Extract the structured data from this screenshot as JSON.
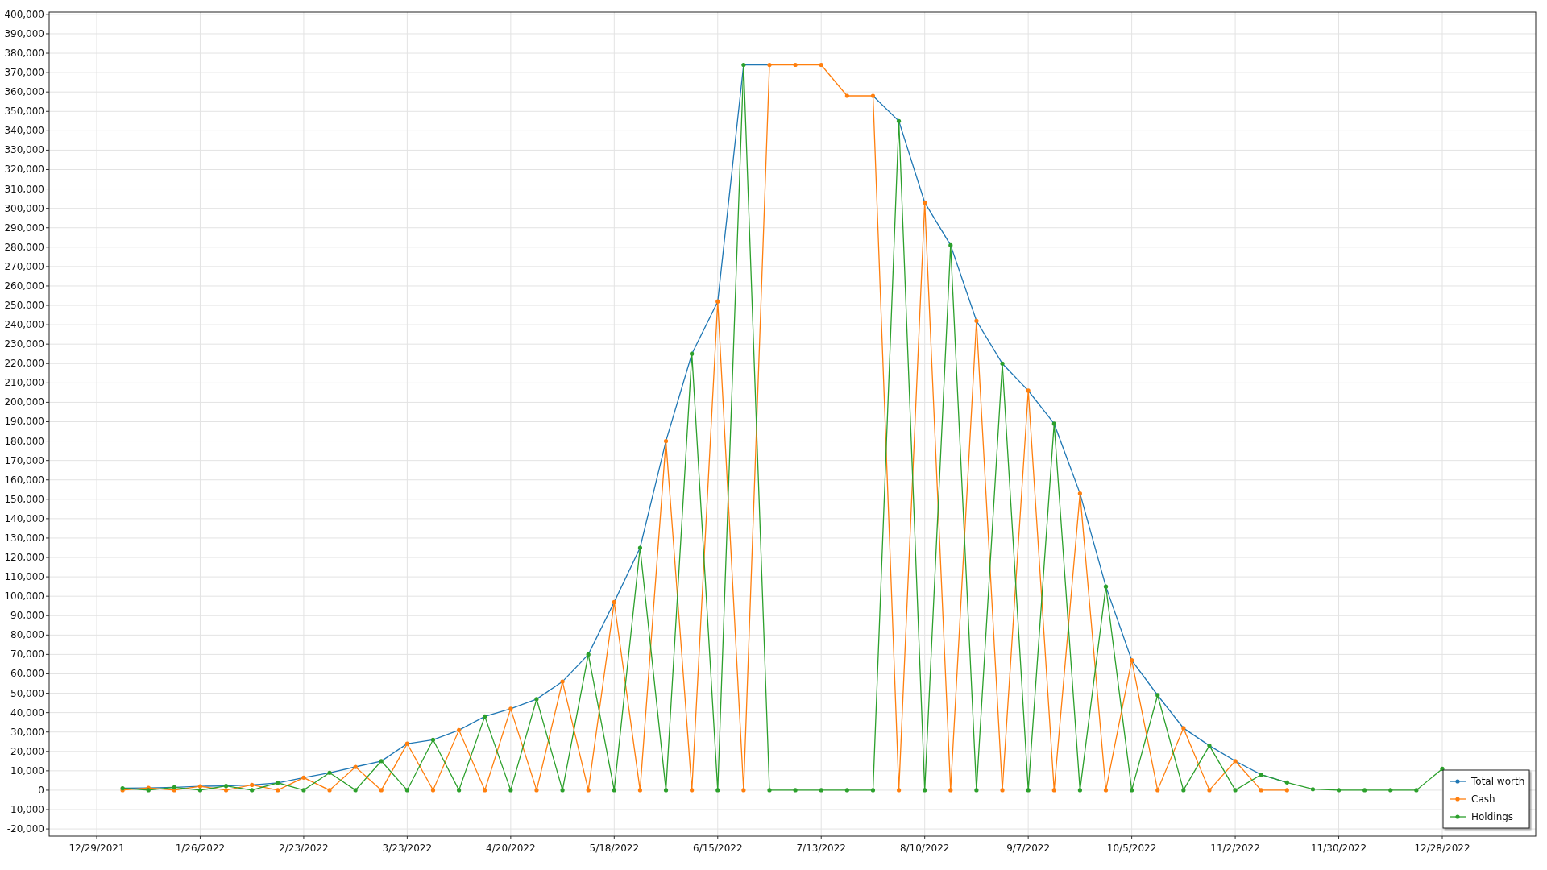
{
  "chart_data": {
    "type": "line",
    "categories": [
      "12/29/2021",
      null,
      null,
      null,
      "1/26/2022",
      null,
      null,
      null,
      "2/23/2022",
      null,
      null,
      null,
      "3/23/2022",
      null,
      null,
      null,
      "4/20/2022",
      null,
      null,
      null,
      "5/18/2022",
      null,
      null,
      null,
      "6/15/2022",
      null,
      null,
      null,
      "7/13/2022",
      null,
      null,
      null,
      "8/10/2022",
      null,
      null,
      null,
      "9/7/2022",
      null,
      null,
      null,
      "10/5/2022",
      null,
      null,
      null,
      "11/2/2022",
      null,
      null,
      null,
      "11/30/2022",
      null,
      null,
      null,
      "12/28/2022"
    ],
    "series": [
      {
        "name": "Total worth",
        "color": "#1f77b4",
        "values": [
          null,
          1000,
          1200,
          1500,
          2000,
          2200,
          2700,
          3800,
          6500,
          9000,
          12000,
          15000,
          24000,
          26000,
          31000,
          38000,
          42000,
          47000,
          56000,
          70000,
          97000,
          125000,
          180000,
          225000,
          252000,
          374000,
          374000,
          null,
          null,
          null,
          358000,
          345000,
          303000,
          281000,
          242000,
          220000,
          206000,
          189000,
          153000,
          105000,
          67000,
          49000,
          32000,
          23000,
          15000,
          8000,
          4000,
          null,
          null,
          null,
          null,
          null,
          null
        ]
      },
      {
        "name": "Cash",
        "color": "#ff7f0e",
        "values": [
          null,
          0,
          1200,
          0,
          2000,
          0,
          2700,
          0,
          6500,
          0,
          12000,
          0,
          24000,
          0,
          31000,
          0,
          42000,
          0,
          56000,
          0,
          97000,
          0,
          180000,
          0,
          252000,
          0,
          374000,
          374000,
          374000,
          358000,
          358000,
          0,
          303000,
          0,
          242000,
          0,
          206000,
          0,
          153000,
          0,
          67000,
          0,
          32000,
          0,
          15000,
          0,
          0,
          null,
          null,
          null,
          null,
          null,
          null
        ]
      },
      {
        "name": "Holdings",
        "color": "#2ca02c",
        "values": [
          null,
          1000,
          0,
          1500,
          0,
          2200,
          0,
          3800,
          0,
          9000,
          0,
          15000,
          0,
          26000,
          0,
          38000,
          0,
          47000,
          0,
          70000,
          0,
          125000,
          0,
          225000,
          0,
          374000,
          0,
          0,
          0,
          0,
          0,
          345000,
          0,
          281000,
          0,
          220000,
          0,
          189000,
          0,
          105000,
          0,
          49000,
          0,
          23000,
          0,
          8000,
          4000,
          500,
          0,
          0,
          0,
          0,
          11000
        ]
      }
    ],
    "ylim": [
      -23700,
      401200
    ],
    "yticks": [
      {
        "value": -20000,
        "label": "-20,000"
      },
      {
        "value": -10000,
        "label": "-10,000"
      },
      {
        "value": 0,
        "label": "0"
      },
      {
        "value": 10000,
        "label": "10,000"
      },
      {
        "value": 20000,
        "label": "20,000"
      },
      {
        "value": 30000,
        "label": "30,000"
      },
      {
        "value": 40000,
        "label": "40,000"
      },
      {
        "value": 50000,
        "label": "50,000"
      },
      {
        "value": 60000,
        "label": "60,000"
      },
      {
        "value": 70000,
        "label": "70,000"
      },
      {
        "value": 80000,
        "label": "80,000"
      },
      {
        "value": 90000,
        "label": "90,000"
      },
      {
        "value": 100000,
        "label": "100,000"
      },
      {
        "value": 110000,
        "label": "110,000"
      },
      {
        "value": 120000,
        "label": "120,000"
      },
      {
        "value": 130000,
        "label": "130,000"
      },
      {
        "value": 140000,
        "label": "140,000"
      },
      {
        "value": 150000,
        "label": "150,000"
      },
      {
        "value": 160000,
        "label": "160,000"
      },
      {
        "value": 170000,
        "label": "170,000"
      },
      {
        "value": 180000,
        "label": "180,000"
      },
      {
        "value": 190000,
        "label": "190,000"
      },
      {
        "value": 200000,
        "label": "200,000"
      },
      {
        "value": 210000,
        "label": "210,000"
      },
      {
        "value": 220000,
        "label": "220,000"
      },
      {
        "value": 230000,
        "label": "230,000"
      },
      {
        "value": 240000,
        "label": "240,000"
      },
      {
        "value": 250000,
        "label": "250,000"
      },
      {
        "value": 260000,
        "label": "260,000"
      },
      {
        "value": 270000,
        "label": "270,000"
      },
      {
        "value": 280000,
        "label": "280,000"
      },
      {
        "value": 290000,
        "label": "290,000"
      },
      {
        "value": 300000,
        "label": "300,000"
      },
      {
        "value": 310000,
        "label": "310,000"
      },
      {
        "value": 320000,
        "label": "320,000"
      },
      {
        "value": 330000,
        "label": "330,000"
      },
      {
        "value": 340000,
        "label": "340,000"
      },
      {
        "value": 350000,
        "label": "350,000"
      },
      {
        "value": 360000,
        "label": "360,000"
      },
      {
        "value": 370000,
        "label": "370,000"
      },
      {
        "value": 380000,
        "label": "380,000"
      },
      {
        "value": 390000,
        "label": "390,000"
      },
      {
        "value": 400000,
        "label": "400,000"
      }
    ],
    "grid": true,
    "legend": true
  }
}
